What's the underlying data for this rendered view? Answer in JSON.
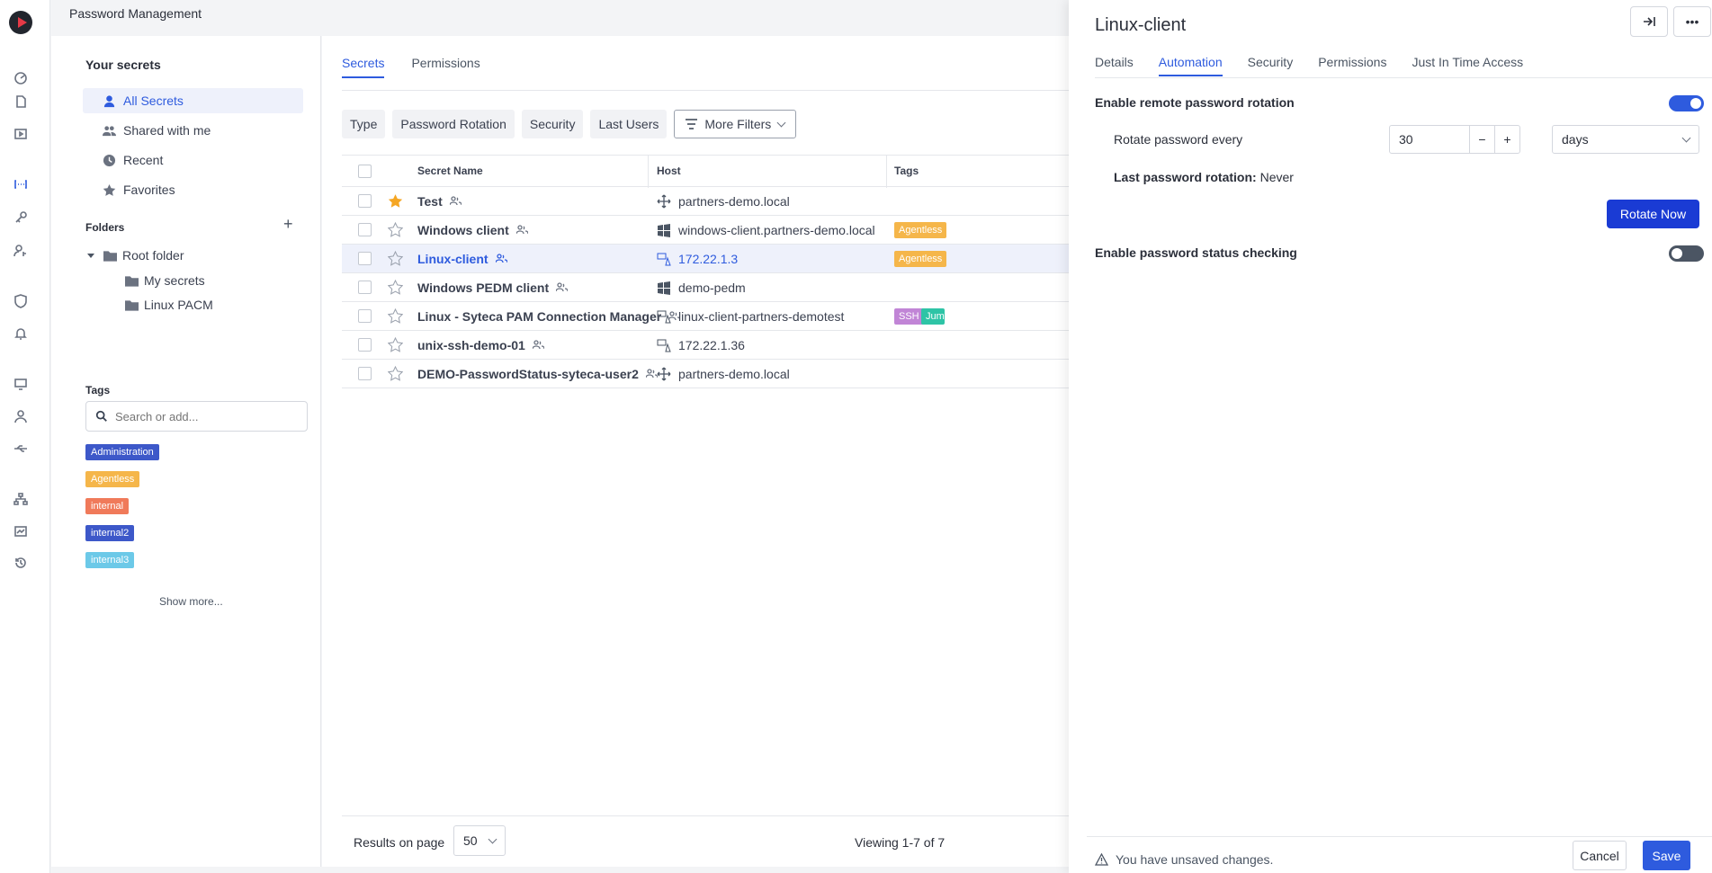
{
  "app": {
    "title": "Password Management"
  },
  "sidebar": {
    "heading": "Your secrets",
    "items": [
      {
        "label": "All Secrets",
        "icon": "person-icon",
        "active": true
      },
      {
        "label": "Shared with me",
        "icon": "people-icon"
      },
      {
        "label": "Recent",
        "icon": "clock-icon"
      },
      {
        "label": "Favorites",
        "icon": "star-icon"
      }
    ],
    "folders_heading": "Folders",
    "folders": {
      "root": "Root folder",
      "children": [
        "My secrets",
        "Linux PACM"
      ]
    },
    "tags_heading": "Tags",
    "tag_search_placeholder": "Search or add...",
    "tags": [
      {
        "label": "Administration",
        "color": "#3d58c9"
      },
      {
        "label": "Agentless",
        "color": "#f5b64a"
      },
      {
        "label": "internal",
        "color": "#f07a5a"
      },
      {
        "label": "internal2",
        "color": "#3d58c9"
      },
      {
        "label": "internal3",
        "color": "#6cc9e8"
      }
    ],
    "show_more": "Show more..."
  },
  "main": {
    "tabs": [
      "Secrets",
      "Permissions"
    ],
    "filters": [
      "Type",
      "Password Rotation",
      "Security",
      "Last Users"
    ],
    "more_filters": "More Filters",
    "columns": [
      "Secret Name",
      "Host",
      "Tags"
    ],
    "rows": [
      {
        "name": "Test",
        "host": "partners-demo.local",
        "host_icon": "network-icon",
        "favorite": true,
        "tags": []
      },
      {
        "name": "Windows client",
        "host": "windows-client.partners-demo.local",
        "host_icon": "windows-icon",
        "favorite": false,
        "tags": [
          "Agentless"
        ]
      },
      {
        "name": "Linux-client",
        "host": "172.22.1.3",
        "host_icon": "linux-ssh-icon",
        "favorite": false,
        "selected": true,
        "tags": [
          "Agentless"
        ]
      },
      {
        "name": "Windows PEDM client",
        "host": "demo-pedm",
        "host_icon": "windows-icon",
        "favorite": false,
        "tags": []
      },
      {
        "name": "Linux - Syteca PAM Connection Manager",
        "host": "linux-client-partners-demotest",
        "host_icon": "linux-ssh-icon",
        "favorite": false,
        "tags": [
          "SSH",
          "Jump"
        ]
      },
      {
        "name": "unix-ssh-demo-01",
        "host": "172.22.1.36",
        "host_icon": "linux-ssh-icon",
        "favorite": false,
        "tags": []
      },
      {
        "name": "DEMO-PasswordStatus-syteca-user2",
        "host": "partners-demo.local",
        "host_icon": "network-icon",
        "favorite": false,
        "tags": []
      }
    ],
    "results_label": "Results on page",
    "page_size": "50",
    "viewing": "Viewing 1-7 of 7"
  },
  "detail": {
    "title": "Linux-client",
    "tabs": [
      "Details",
      "Automation",
      "Security",
      "Permissions",
      "Just In Time Access"
    ],
    "active_tab": "Automation",
    "remote_rotation_label": "Enable remote password rotation",
    "remote_rotation_enabled": true,
    "rotate_every_label": "Rotate password every",
    "rotate_every_value": "30",
    "rotate_unit": "days",
    "last_rotation_label": "Last password rotation:",
    "last_rotation_value": "Never",
    "rotate_now": "Rotate Now",
    "status_checking_label": "Enable password status checking",
    "status_checking_enabled": false,
    "unsaved_message": "You have unsaved changes.",
    "cancel": "Cancel",
    "save": "Save"
  },
  "colors": {
    "accent": "#2e5bde",
    "rotate_button": "#1a3bd4",
    "favorite_star": "#f5a623",
    "tag_ssh": "#c185d6",
    "tag_jump": "#2ec4a6"
  }
}
